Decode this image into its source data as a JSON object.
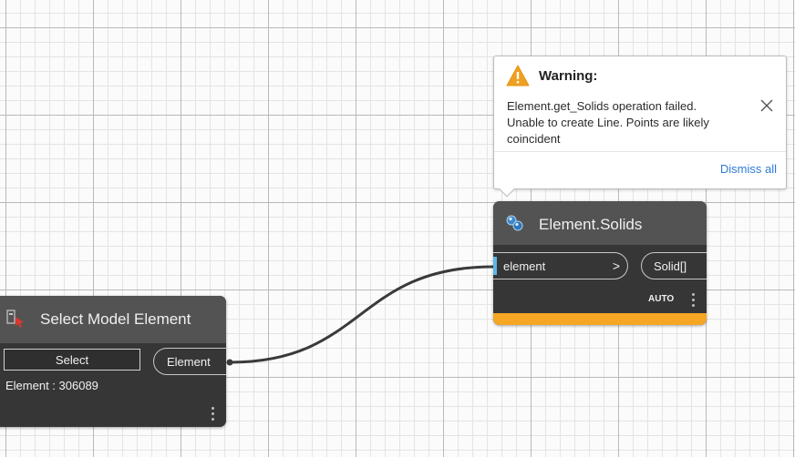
{
  "warning": {
    "title": "Warning:",
    "message": "Element.get_Solids operation failed. Unable to create Line. Points are likely coincident",
    "dismiss_label": "Dismiss all",
    "icon": "warning-triangle-icon",
    "close_icon": "close-icon"
  },
  "nodes": {
    "select_model_element": {
      "title": "Select Model Element",
      "button_label": "Select",
      "value_text": "Element : 306089",
      "output_port": "Element",
      "icon": "select-model-element-icon"
    },
    "element_solids": {
      "title": "Element.Solids",
      "input_port": "element",
      "input_chevron": ">",
      "output_port": "Solid[]",
      "lacing": "AUTO",
      "icon": "element-solids-icon"
    }
  },
  "colors": {
    "node_body": "#363636",
    "node_header": "#535353",
    "warning_strip": "#f5a623",
    "port_connected": "#5bb6e5",
    "link": "#2f7bd6",
    "wire": "#3a3a3a"
  }
}
